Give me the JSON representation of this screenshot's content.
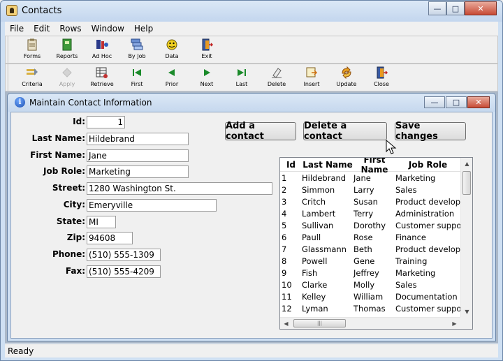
{
  "window": {
    "title": "Contacts",
    "controls": {
      "minimize": "—",
      "maximize": "□",
      "close": "✕"
    }
  },
  "menu": [
    "File",
    "Edit",
    "Rows",
    "Window",
    "Help"
  ],
  "toolbar1": [
    {
      "label": "Forms",
      "icon": "forms-icon"
    },
    {
      "label": "Reports",
      "icon": "reports-icon"
    },
    {
      "label": "Ad Hoc",
      "icon": "adhoc-icon"
    },
    {
      "label": "By Job",
      "icon": "byjob-icon"
    },
    {
      "label": "Data",
      "icon": "data-icon"
    },
    {
      "label": "Exit",
      "icon": "exit-icon"
    }
  ],
  "toolbar2": [
    {
      "label": "Criteria",
      "icon": "criteria-icon",
      "enabled": true
    },
    {
      "label": "Apply",
      "icon": "apply-icon",
      "enabled": false
    },
    {
      "label": "Retrieve",
      "icon": "retrieve-icon",
      "enabled": true
    },
    {
      "label": "First",
      "icon": "first-icon",
      "enabled": true
    },
    {
      "label": "Prior",
      "icon": "prior-icon",
      "enabled": true
    },
    {
      "label": "Next",
      "icon": "next-icon",
      "enabled": true
    },
    {
      "label": "Last",
      "icon": "last-icon",
      "enabled": true
    },
    {
      "label": "Delete",
      "icon": "delete-icon",
      "enabled": true
    },
    {
      "label": "Insert",
      "icon": "insert-icon",
      "enabled": true
    },
    {
      "label": "Update",
      "icon": "update-icon",
      "enabled": true
    },
    {
      "label": "Close",
      "icon": "close-icon",
      "enabled": true
    }
  ],
  "child": {
    "title": "Maintain Contact Information",
    "controls": {
      "minimize": "—",
      "maximize": "□",
      "close": "✕"
    }
  },
  "form": {
    "id": {
      "label": "Id:",
      "value": "1"
    },
    "last_name": {
      "label": "Last Name:",
      "value": "Hildebrand"
    },
    "first_name": {
      "label": "First Name:",
      "value": "Jane"
    },
    "job_role": {
      "label": "Job Role:",
      "value": "Marketing"
    },
    "street": {
      "label": "Street:",
      "value": "1280 Washington St."
    },
    "city": {
      "label": "City:",
      "value": "Emeryville"
    },
    "state": {
      "label": "State:",
      "value": "MI"
    },
    "zip": {
      "label": "Zip:",
      "value": "94608"
    },
    "phone": {
      "label": "Phone:",
      "value": "(510) 555-1309"
    },
    "fax": {
      "label": "Fax:",
      "value": "(510) 555-4209"
    }
  },
  "buttons": {
    "add": "Add a contact",
    "delete": "Delete a contact",
    "save": "Save changes"
  },
  "grid": {
    "headers": [
      "Id",
      "Last Name",
      "First Name",
      "Job Role"
    ],
    "rows": [
      [
        "1",
        "Hildebrand",
        "Jane",
        "Marketing"
      ],
      [
        "2",
        "Simmon",
        "Larry",
        "Sales"
      ],
      [
        "3",
        "Critch",
        "Susan",
        "Product developme"
      ],
      [
        "4",
        "Lambert",
        "Terry",
        "Administration"
      ],
      [
        "5",
        "Sullivan",
        "Dorothy",
        "Customer support"
      ],
      [
        "6",
        "Paull",
        "Rose",
        "Finance"
      ],
      [
        "7",
        "Glassmann",
        "Beth",
        "Product developme"
      ],
      [
        "8",
        "Powell",
        "Gene",
        "Training"
      ],
      [
        "9",
        "Fish",
        "Jeffrey",
        "Marketing"
      ],
      [
        "10",
        "Clarke",
        "Molly",
        "Sales"
      ],
      [
        "11",
        "Kelley",
        "William",
        "Documentation"
      ],
      [
        "12",
        "Lyman",
        "Thomas",
        "Customer support"
      ]
    ]
  },
  "status": "Ready"
}
